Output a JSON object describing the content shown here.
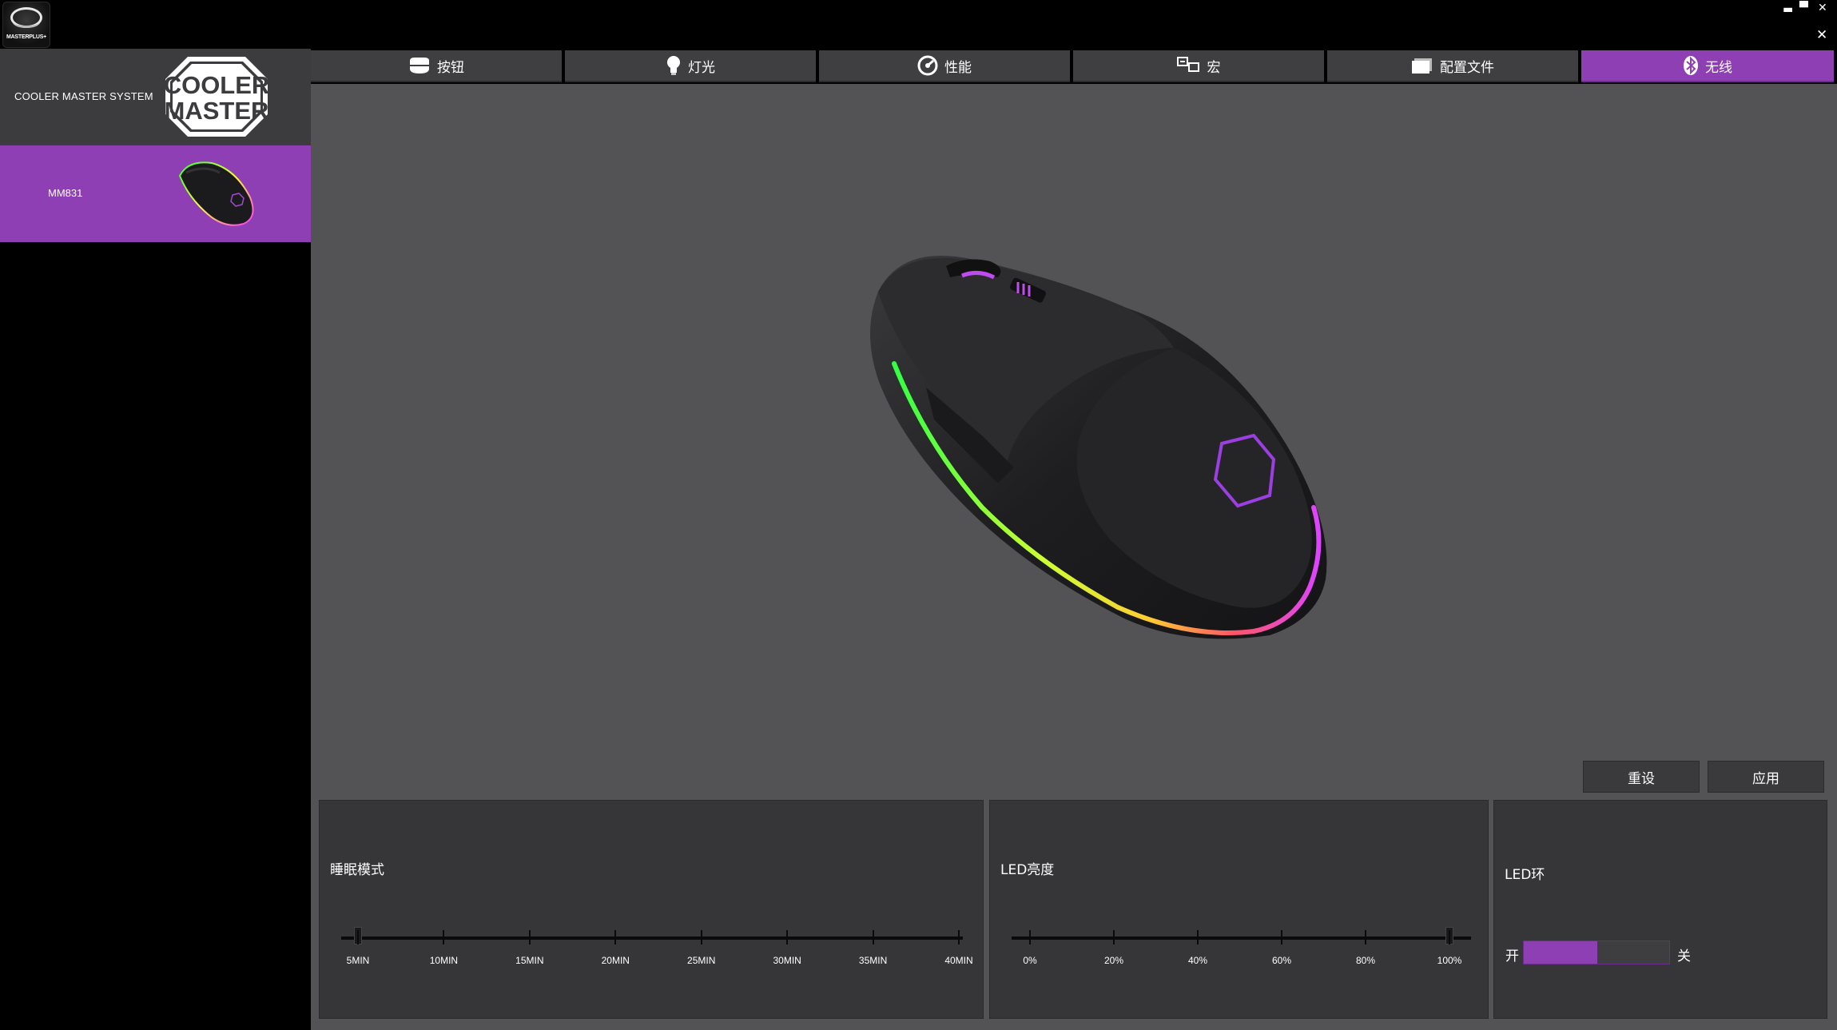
{
  "app": {
    "logo_text": "MASTERPLUS+"
  },
  "window_controls": {
    "minimize": "▬",
    "maximize": "▀",
    "close": "✕",
    "close_alt": "✕"
  },
  "sidebar": {
    "brand": "COOLER MASTER SYSTEM",
    "brand_logo_text": [
      "COOLER",
      "MASTER"
    ],
    "device": "MM831"
  },
  "tabs": [
    {
      "label": "按钮",
      "icon": "mouse-buttons-icon"
    },
    {
      "label": "灯光",
      "icon": "light-bulb-icon"
    },
    {
      "label": "性能",
      "icon": "performance-dial-icon"
    },
    {
      "label": "宏",
      "icon": "macro-icon"
    },
    {
      "label": "配置文件",
      "icon": "profile-folder-icon"
    },
    {
      "label": "无线",
      "icon": "bluetooth-icon",
      "active": true
    }
  ],
  "actions": {
    "reset": "重设",
    "apply": "应用"
  },
  "sleep_panel": {
    "title": "睡眠模式",
    "ticks": [
      "5MIN",
      "10MIN",
      "15MIN",
      "20MIN",
      "25MIN",
      "30MIN",
      "35MIN",
      "40MIN"
    ],
    "selected_index": 0
  },
  "led_brightness_panel": {
    "title": "LED亮度",
    "ticks": [
      "0%",
      "20%",
      "40%",
      "60%",
      "80%",
      "100%"
    ],
    "value_percent": 100
  },
  "led_ring_panel": {
    "title": "LED环",
    "on_label": "开",
    "off_label": "关",
    "state": "on"
  },
  "colors": {
    "accent": "#8e3fb3",
    "panel": "#363638",
    "main_bg": "#535356",
    "tab": "#3f3f41"
  }
}
